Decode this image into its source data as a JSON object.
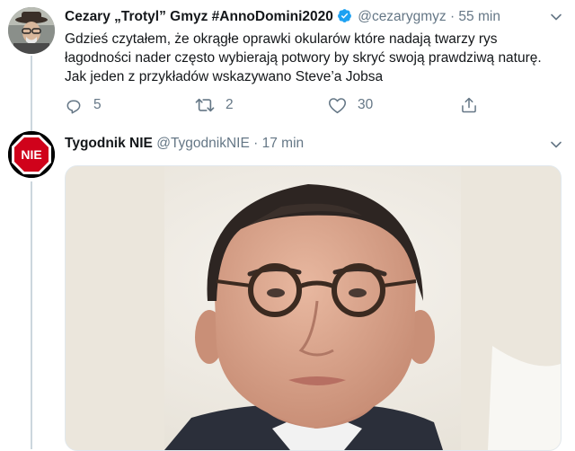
{
  "tweets": [
    {
      "author_name": "Cezary „Trotyl” Gmyz #AnnoDomini2020",
      "handle": "@cezarygmyz",
      "separator": "·",
      "time": "55 min",
      "verified": true,
      "text": "Gdzieś czytałem, że okrągłe oprawki okularów które nadają twarzy rys łagodności nader często wybierają potwory by skryć swoją prawdziwą naturę. Jak jeden z przykładów wskazywano Steve’a Jobsa",
      "reply_count": "5",
      "retweet_count": "2",
      "like_count": "30"
    },
    {
      "author_name": "Tygodnik NIE",
      "handle": "@TygodnikNIE",
      "separator": "·",
      "time": "17 min",
      "avatar_text": "NIE"
    }
  ],
  "icons": [
    "verified-badge-icon",
    "chevron-down-icon",
    "reply-icon",
    "retweet-icon",
    "like-icon",
    "share-icon"
  ],
  "colors": {
    "link": "#1da1f2",
    "muted": "#657786",
    "border": "#e1e8ed",
    "thread": "#ccd6dd",
    "stop_red": "#d0021b"
  }
}
